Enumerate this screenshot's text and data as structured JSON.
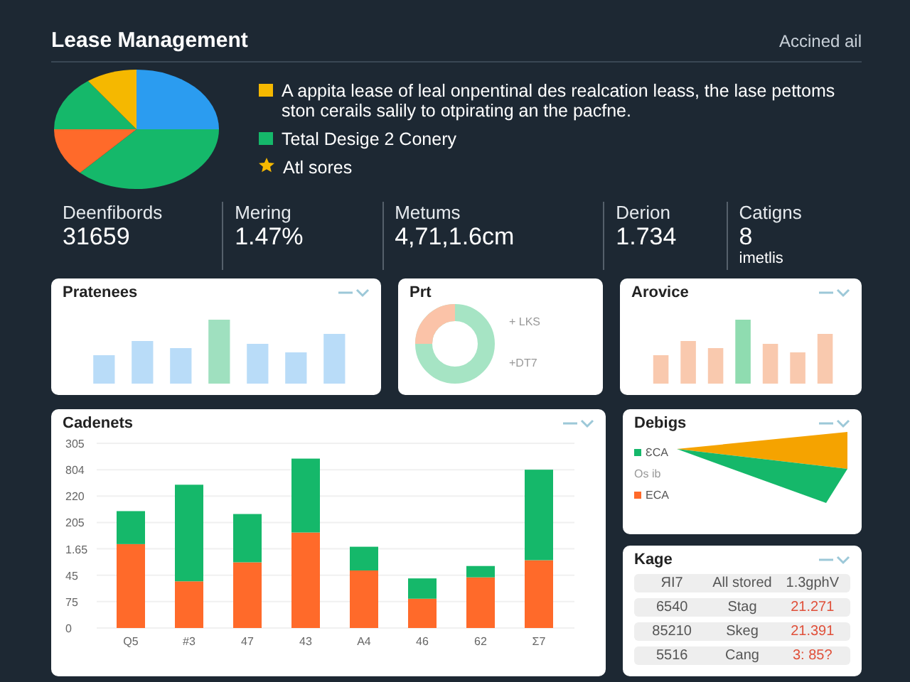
{
  "header": {
    "title": "Lease Management",
    "action": "Accined ail"
  },
  "summary": {
    "legend": [
      {
        "kind": "square",
        "color": "#f5b800",
        "text": "A appita lease of leal onpentinal des realcation leass, the lase pettoms ston cerails salily to otpirating an the pacfne."
      },
      {
        "kind": "square",
        "color": "#15b86a",
        "text": "Tetal Desige 2 Conery"
      },
      {
        "kind": "star",
        "color": "#f5b800",
        "text": "Atl sores"
      }
    ]
  },
  "stats": [
    {
      "label": "Deenfibords",
      "value": "31659"
    },
    {
      "label": "Mering",
      "value": "1.47%"
    },
    {
      "label": "Metums",
      "value": "4,71,1.6cm"
    },
    {
      "label": "Derion",
      "value": "1.734"
    },
    {
      "label": "Catigns",
      "value": "8",
      "unit": "imetlis"
    }
  ],
  "mini_cards": [
    {
      "kind": "bars",
      "title": "Pratenees"
    },
    {
      "kind": "donut",
      "title": "Prt",
      "labels": [
        "+ LKS",
        "+DT7"
      ]
    },
    {
      "kind": "bars",
      "title": "Arovice"
    }
  ],
  "bar_card": {
    "title": "Cadenets",
    "x_axis_labels": [
      "Q5",
      "#3",
      "47",
      "43",
      "A4",
      "46",
      "62",
      "Ʃ7"
    ],
    "y_axis_labels": [
      "305",
      "804",
      "220",
      "205",
      "1.65",
      "45",
      "75",
      "0"
    ]
  },
  "design_card": {
    "title": "Debigs",
    "labels": [
      {
        "text": "ƐCA",
        "color": "#15b86a"
      },
      {
        "text": "ECA",
        "color": "#ff6a2a"
      }
    ],
    "axis_label": "Os ib"
  },
  "table_card": {
    "title": "Kage",
    "rows": [
      {
        "code": "ЯI7",
        "name": "All stored",
        "value": "1.3gphV",
        "alert": false
      },
      {
        "code": "6540",
        "name": "Stag",
        "value": "21.271",
        "alert": true
      },
      {
        "code": "85210",
        "name": "Skeg",
        "value": "21.391",
        "alert": true
      },
      {
        "code": "5516",
        "name": "Cang",
        "value": "3: 85?",
        "alert": true
      }
    ]
  }
}
